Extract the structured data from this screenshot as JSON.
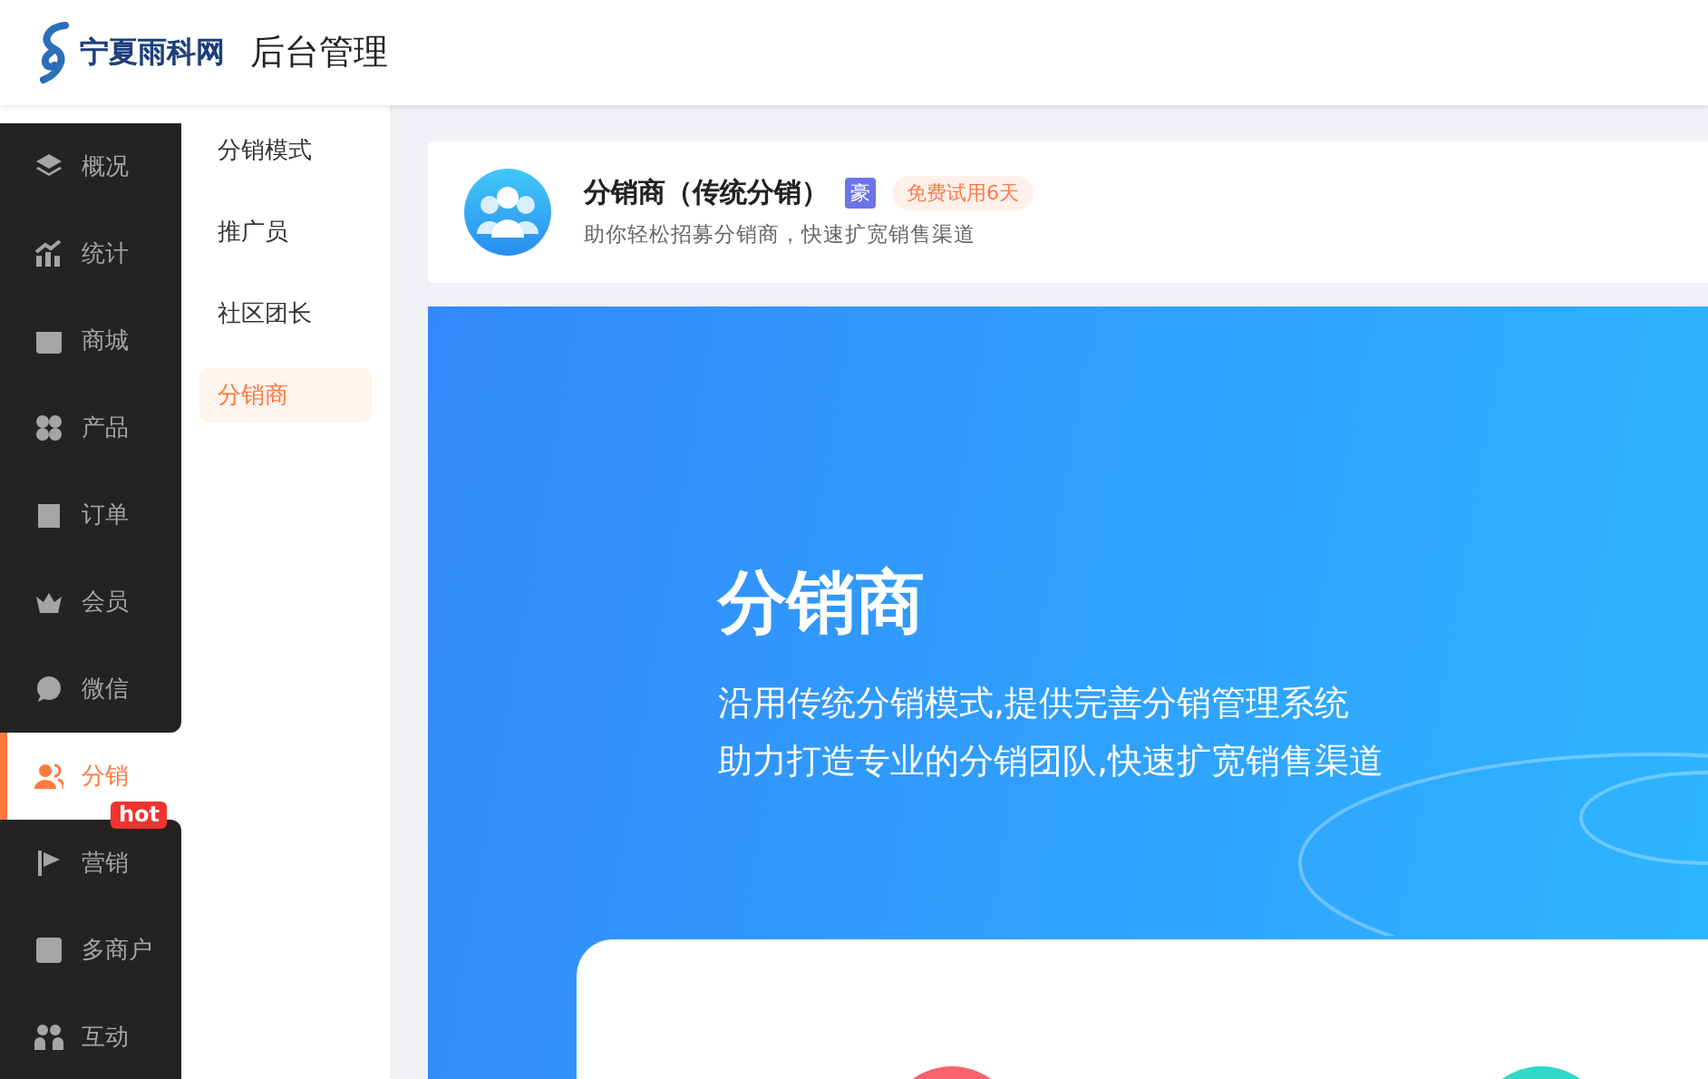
{
  "header": {
    "logo_text": "宁夏雨科网",
    "title": "后台管理"
  },
  "sidebar": {
    "items": [
      {
        "label": "概况",
        "selected": false
      },
      {
        "label": "统计",
        "selected": false
      },
      {
        "label": "商城",
        "selected": false
      },
      {
        "label": "产品",
        "selected": false
      },
      {
        "label": "订单",
        "selected": false
      },
      {
        "label": "会员",
        "selected": false
      },
      {
        "label": "微信",
        "selected": false
      },
      {
        "label": "分销",
        "selected": true
      },
      {
        "label": "营销",
        "selected": false,
        "badge": "hot"
      },
      {
        "label": "多商户",
        "selected": false
      },
      {
        "label": "互动",
        "selected": false
      }
    ]
  },
  "submenu": {
    "items": [
      {
        "label": "分销模式",
        "selected": false
      },
      {
        "label": "推广员",
        "selected": false
      },
      {
        "label": "社区团长",
        "selected": false
      },
      {
        "label": "分销商",
        "selected": true
      }
    ]
  },
  "plugin_card": {
    "title": "分销商（传统分销）",
    "tag": "豪",
    "trial": "免费试用6天",
    "subtitle": "助你轻松招募分销商，快速扩宽销售渠道"
  },
  "banner": {
    "heading": "分销商",
    "lines": [
      "沿用传统分销模式,提供完善分销管理系统",
      "助力打造专业的分销团队,快速扩宽销售渠道"
    ]
  }
}
